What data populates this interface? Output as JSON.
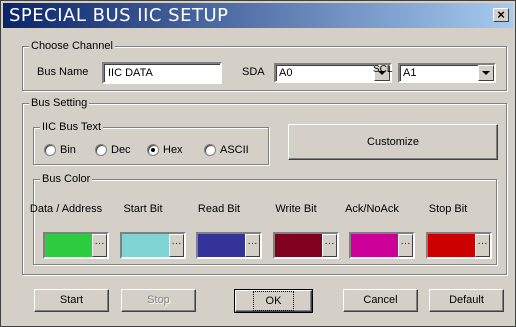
{
  "window": {
    "title": "SPECIAL BUS IIC SETUP",
    "close_glyph": "×"
  },
  "choose_channel": {
    "group_label": "Choose Channel",
    "bus_name_label": "Bus Name",
    "bus_name_value": "IIC DATA",
    "sda_label": "SDA",
    "sda_value": "A0",
    "scl_label": "SCL",
    "scl_value": "A1"
  },
  "bus_setting": {
    "group_label": "Bus Setting",
    "text_group_label": "IIC Bus Text",
    "radios": [
      {
        "label": "Bin",
        "selected": false
      },
      {
        "label": "Dec",
        "selected": false
      },
      {
        "label": "Hex",
        "selected": true
      },
      {
        "label": "ASCII",
        "selected": false
      }
    ],
    "customize_label": "Customize",
    "color_group_label": "Bus Color",
    "colors": [
      {
        "label": "Data / Address",
        "color": "#2ecc40"
      },
      {
        "label": "Start Bit",
        "color": "#80d4d4"
      },
      {
        "label": "Read Bit",
        "color": "#333399"
      },
      {
        "label": "Write Bit",
        "color": "#800020"
      },
      {
        "label": "Ack/NoAck",
        "color": "#cc0099"
      },
      {
        "label": "Stop Bit",
        "color": "#cc0000"
      }
    ],
    "ellipsis": "···"
  },
  "buttons": {
    "start": "Start",
    "stop": "Stop",
    "ok": "OK",
    "cancel": "Cancel",
    "default": "Default"
  }
}
